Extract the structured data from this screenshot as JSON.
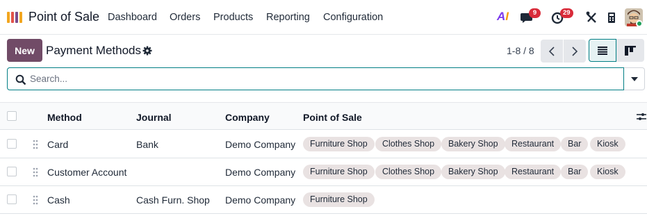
{
  "app": {
    "name": "Point of Sale"
  },
  "nav": {
    "menus": [
      "Dashboard",
      "Orders",
      "Products",
      "Reporting",
      "Configuration"
    ],
    "ai_label_a": "A",
    "ai_label_i": "I",
    "messages_badge": "9",
    "activities_badge": "29"
  },
  "control_panel": {
    "new_label": "New",
    "title": "Payment Methods",
    "pager": "1-8 / 8"
  },
  "search": {
    "placeholder": "Search..."
  },
  "table": {
    "headers": {
      "method": "Method",
      "journal": "Journal",
      "company": "Company",
      "pos": "Point of Sale"
    },
    "rows": [
      {
        "method": "Card",
        "journal": "Bank",
        "company": "Demo Company",
        "pos": [
          "Furniture Shop",
          "Clothes Shop",
          "Bakery Shop",
          "Restaurant",
          "Bar",
          "Kiosk"
        ]
      },
      {
        "method": "Customer Account",
        "journal": "",
        "company": "Demo Company",
        "pos": [
          "Furniture Shop",
          "Clothes Shop",
          "Bakery Shop",
          "Restaurant",
          "Bar",
          "Kiosk"
        ]
      },
      {
        "method": "Cash",
        "journal": "Cash Furn. Shop",
        "company": "Demo Company",
        "pos": [
          "Furniture Shop"
        ]
      }
    ]
  },
  "colors": {
    "brand": "#714b67",
    "accent": "#017e84",
    "badge": "#d92b3a",
    "tag_bg": "#e9e2e2"
  }
}
